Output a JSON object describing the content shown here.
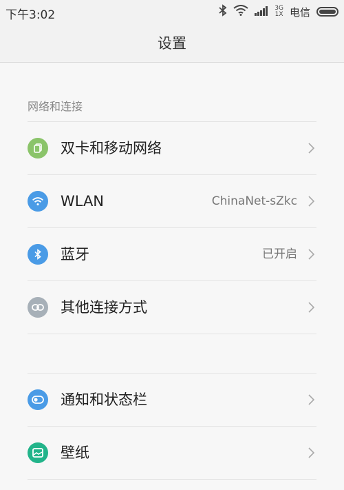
{
  "status_bar": {
    "time": "下午3:02",
    "network_top": "3G",
    "network_bottom": "1X",
    "carrier": "电信",
    "icons": [
      "bluetooth-icon",
      "wifi-icon",
      "signal-icon",
      "battery-icon"
    ]
  },
  "header": {
    "title": "设置"
  },
  "section_network": {
    "label": "网络和连接",
    "items": [
      {
        "label": "双卡和移动网络",
        "value": "",
        "icon": "sim-card-icon",
        "color": "#8bc46a"
      },
      {
        "label": "WLAN",
        "value": "ChinaNet-sZkc",
        "icon": "wifi-icon",
        "color": "#4a9be6"
      },
      {
        "label": "蓝牙",
        "value": "已开启",
        "icon": "bluetooth-icon",
        "color": "#4a9be6"
      },
      {
        "label": "其他连接方式",
        "value": "",
        "icon": "link-icon",
        "color": "#a7b0b8"
      }
    ]
  },
  "section_display": {
    "items": [
      {
        "label": "通知和状态栏",
        "value": "",
        "icon": "toggle-icon",
        "color": "#4a9be6"
      },
      {
        "label": "壁纸",
        "value": "",
        "icon": "wallpaper-icon",
        "color": "#22b48a"
      }
    ]
  }
}
